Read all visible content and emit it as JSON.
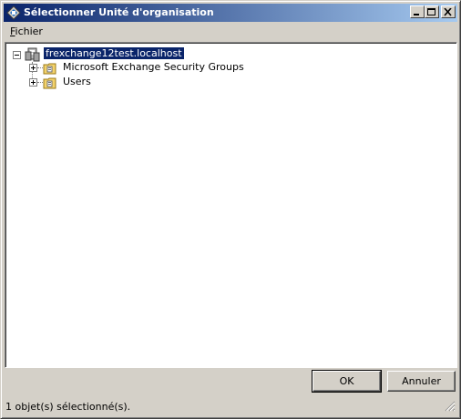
{
  "window": {
    "title": "Sélectionner Unité d'organisation"
  },
  "menu": {
    "file_label": "Fichier"
  },
  "tree": {
    "root": {
      "label": "frexchange12test.localhost",
      "icon": "domain-icon",
      "expanded": true,
      "selected": true
    },
    "children": [
      {
        "label": "Microsoft Exchange Security Groups",
        "icon": "organizational-unit-icon",
        "expanded": false
      },
      {
        "label": "Users",
        "icon": "organizational-unit-icon",
        "expanded": false
      }
    ]
  },
  "buttons": {
    "ok": "OK",
    "cancel": "Annuler"
  },
  "status": {
    "text": "1 objet(s) sélectionné(s)."
  },
  "colors": {
    "titlebar_start": "#0a246a",
    "titlebar_end": "#a6caf0",
    "face": "#d4d0c8",
    "selection": "#0a246a"
  }
}
